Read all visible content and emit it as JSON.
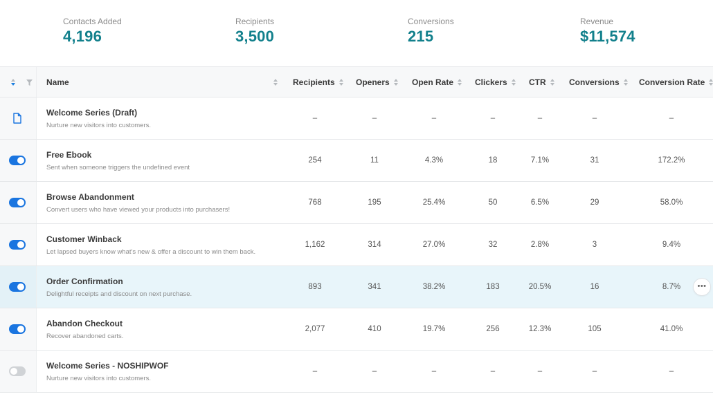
{
  "stats": [
    {
      "label": "Contacts Added",
      "value": "4,196"
    },
    {
      "label": "Recipients",
      "value": "3,500"
    },
    {
      "label": "Conversions",
      "value": "215"
    },
    {
      "label": "Revenue",
      "value": "$11,574"
    }
  ],
  "table": {
    "columns": [
      "Name",
      "Recipients",
      "Openers",
      "Open Rate",
      "Clickers",
      "CTR",
      "Conversions",
      "Conversion Rate"
    ],
    "rows": [
      {
        "title": "Welcome Series (Draft)",
        "desc": "Nurture new visitors into customers.",
        "status": "draft",
        "values": [
          "–",
          "–",
          "–",
          "–",
          "–",
          "–",
          "–"
        ]
      },
      {
        "title": "Free Ebook",
        "desc": "Sent when someone triggers the undefined event",
        "status": "on",
        "values": [
          "254",
          "11",
          "4.3%",
          "18",
          "7.1%",
          "31",
          "172.2%"
        ]
      },
      {
        "title": "Browse Abandonment",
        "desc": "Convert users who have viewed your products into purchasers!",
        "status": "on",
        "values": [
          "768",
          "195",
          "25.4%",
          "50",
          "6.5%",
          "29",
          "58.0%"
        ]
      },
      {
        "title": "Customer Winback",
        "desc": "Let lapsed buyers know what's new & offer a discount to win them back.",
        "status": "on",
        "values": [
          "1,162",
          "314",
          "27.0%",
          "32",
          "2.8%",
          "3",
          "9.4%"
        ]
      },
      {
        "title": "Order Confirmation",
        "desc": "Delightful receipts and discount on next purchase.",
        "status": "on",
        "values": [
          "893",
          "341",
          "38.2%",
          "183",
          "20.5%",
          "16",
          "8.7%"
        ]
      },
      {
        "title": "Abandon Checkout",
        "desc": "Recover abandoned carts.",
        "status": "on",
        "values": [
          "2,077",
          "410",
          "19.7%",
          "256",
          "12.3%",
          "105",
          "41.0%"
        ]
      },
      {
        "title": "Welcome Series - NOSHIPWOF",
        "desc": "Nurture new visitors into customers.",
        "status": "off",
        "values": [
          "–",
          "–",
          "–",
          "–",
          "–",
          "–",
          "–"
        ]
      }
    ]
  },
  "more_menu_label": "•••",
  "icons": {
    "sort": "sort-icon",
    "filter": "filter-icon",
    "draft": "document-icon",
    "toggle": "toggle-switch"
  },
  "colors": {
    "accent": "#12808c",
    "toggle_on": "#1a75e0",
    "toggle_off": "#d0d3d6",
    "highlight_row": "#e8f5fa"
  }
}
